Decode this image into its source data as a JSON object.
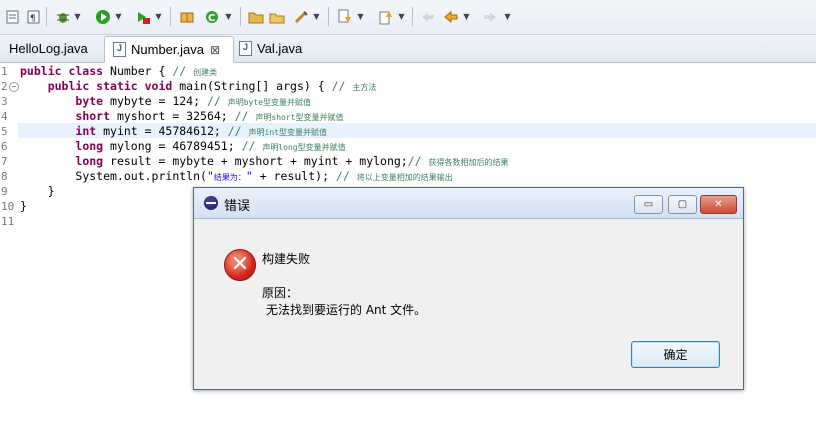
{
  "toolbar": {
    "icons": [
      "save-all-icon",
      "paragraph-icon",
      "debug-icon",
      "run-icon",
      "external-tools-icon",
      "new-java-package-icon",
      "refresh-icon",
      "open-folder-icon",
      "open-type-icon",
      "pen-icon",
      "next-annotation-icon",
      "previous-annotation-icon",
      "back-icon",
      "forward-icon"
    ]
  },
  "tabs": [
    {
      "label": "HelloLog.java"
    },
    {
      "label": "Number.java",
      "close": "⊠"
    },
    {
      "label": "Val.java"
    }
  ],
  "editor": {
    "line_numbers": [
      "1",
      "2",
      "3",
      "4",
      "5",
      "6",
      "7",
      "8",
      "9",
      "10",
      "11"
    ],
    "lines": [
      {
        "kw": "public class",
        "text": " Number { ",
        "comment": "// ",
        "small": "创建类"
      },
      {
        "indent": "    ",
        "kw": "public static void",
        "text": " main(String[] args) { ",
        "comment": "// ",
        "small": "主方法"
      },
      {
        "indent": "        ",
        "kw": "byte",
        "text": " mybyte = 124; ",
        "comment": "// ",
        "small": "声明byte型变量并赋值"
      },
      {
        "indent": "        ",
        "kw": "short",
        "text": " myshort = 32564; ",
        "comment": "// ",
        "small": "声明short型变量并赋值"
      },
      {
        "indent": "        ",
        "kw": "int",
        "text": " myint = 45784612; ",
        "comment": "// ",
        "small": "声明int型变量并赋值"
      },
      {
        "indent": "        ",
        "kw": "long",
        "text": " mylong = 46789451; ",
        "comment": "// ",
        "small": "声明long型变量并赋值"
      },
      {
        "indent": "        ",
        "kw": "long",
        "text": " result = mybyte + myshort + myint + mylong;",
        "comment": "// ",
        "small": "获得各数相加后的结果"
      },
      {
        "indent": "        ",
        "text_pre": "System.out.println(",
        "str": "\"",
        "str_small": "结果为：",
        "str_end": "\"",
        "text_post": " + result); ",
        "comment": "// ",
        "small": "将以上变量相加的结果输出"
      },
      {
        "indent": "    ",
        "text": "}"
      },
      {
        "text": "}"
      },
      {
        "text": ""
      }
    ]
  },
  "dialog": {
    "title": "错误",
    "minimize": "▭",
    "maximize": "▢",
    "close": "✕",
    "icon": "error-icon",
    "heading": "构建失败",
    "reason_label": "原因：",
    "reason": "无法找到要运行的 Ant 文件。",
    "ok_label": "确定"
  }
}
